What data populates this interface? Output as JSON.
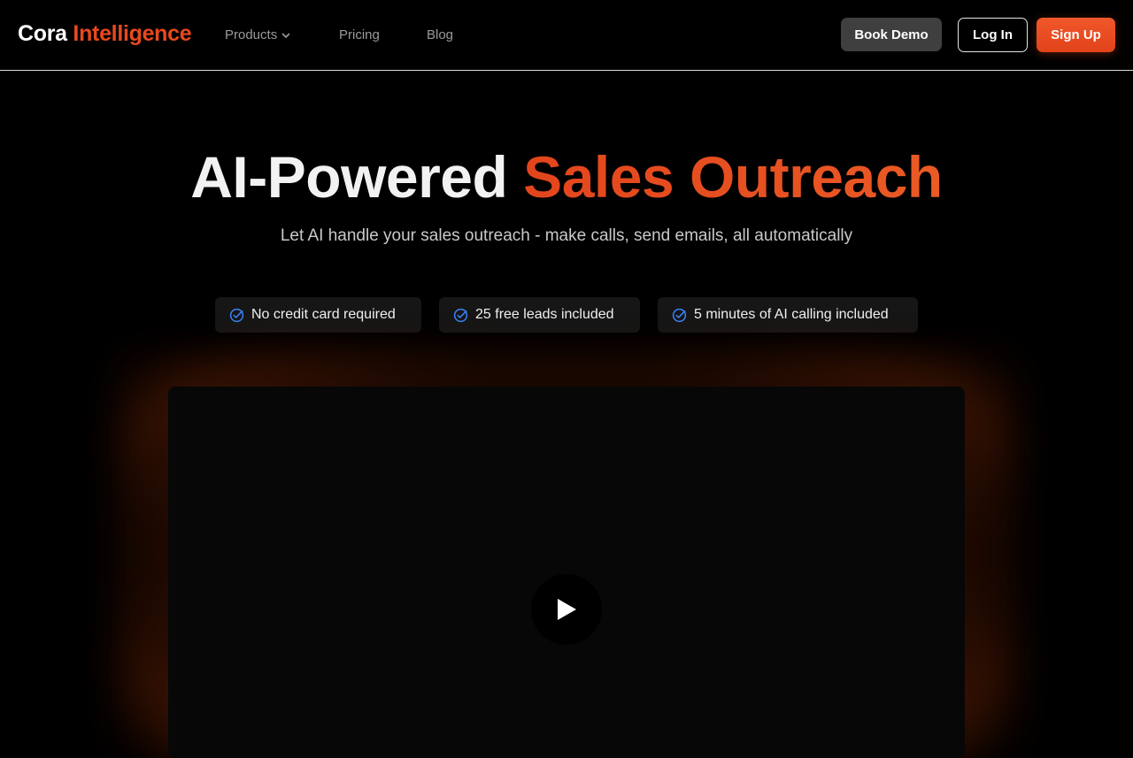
{
  "brand": {
    "part1": "Cora",
    "part2": "Intelligence"
  },
  "nav": {
    "products": "Products",
    "pricing": "Pricing",
    "blog": "Blog",
    "book_demo": "Book Demo",
    "login": "Log In",
    "signup": "Sign Up"
  },
  "hero": {
    "title_a": "AI-Powered",
    "title_b": "Sales Outreach",
    "subtitle": "Let AI handle your sales outreach - make calls, send emails, all automatically"
  },
  "badges": [
    "No credit card required",
    "25 free leads included",
    "5 minutes of AI calling included"
  ],
  "icons": {
    "products_dropdown": "chevron-down-icon",
    "badge": "check-circle-icon",
    "video": "play-icon"
  },
  "colors": {
    "accent": "#e8491d",
    "check": "#3b82f6",
    "background": "#000000"
  }
}
